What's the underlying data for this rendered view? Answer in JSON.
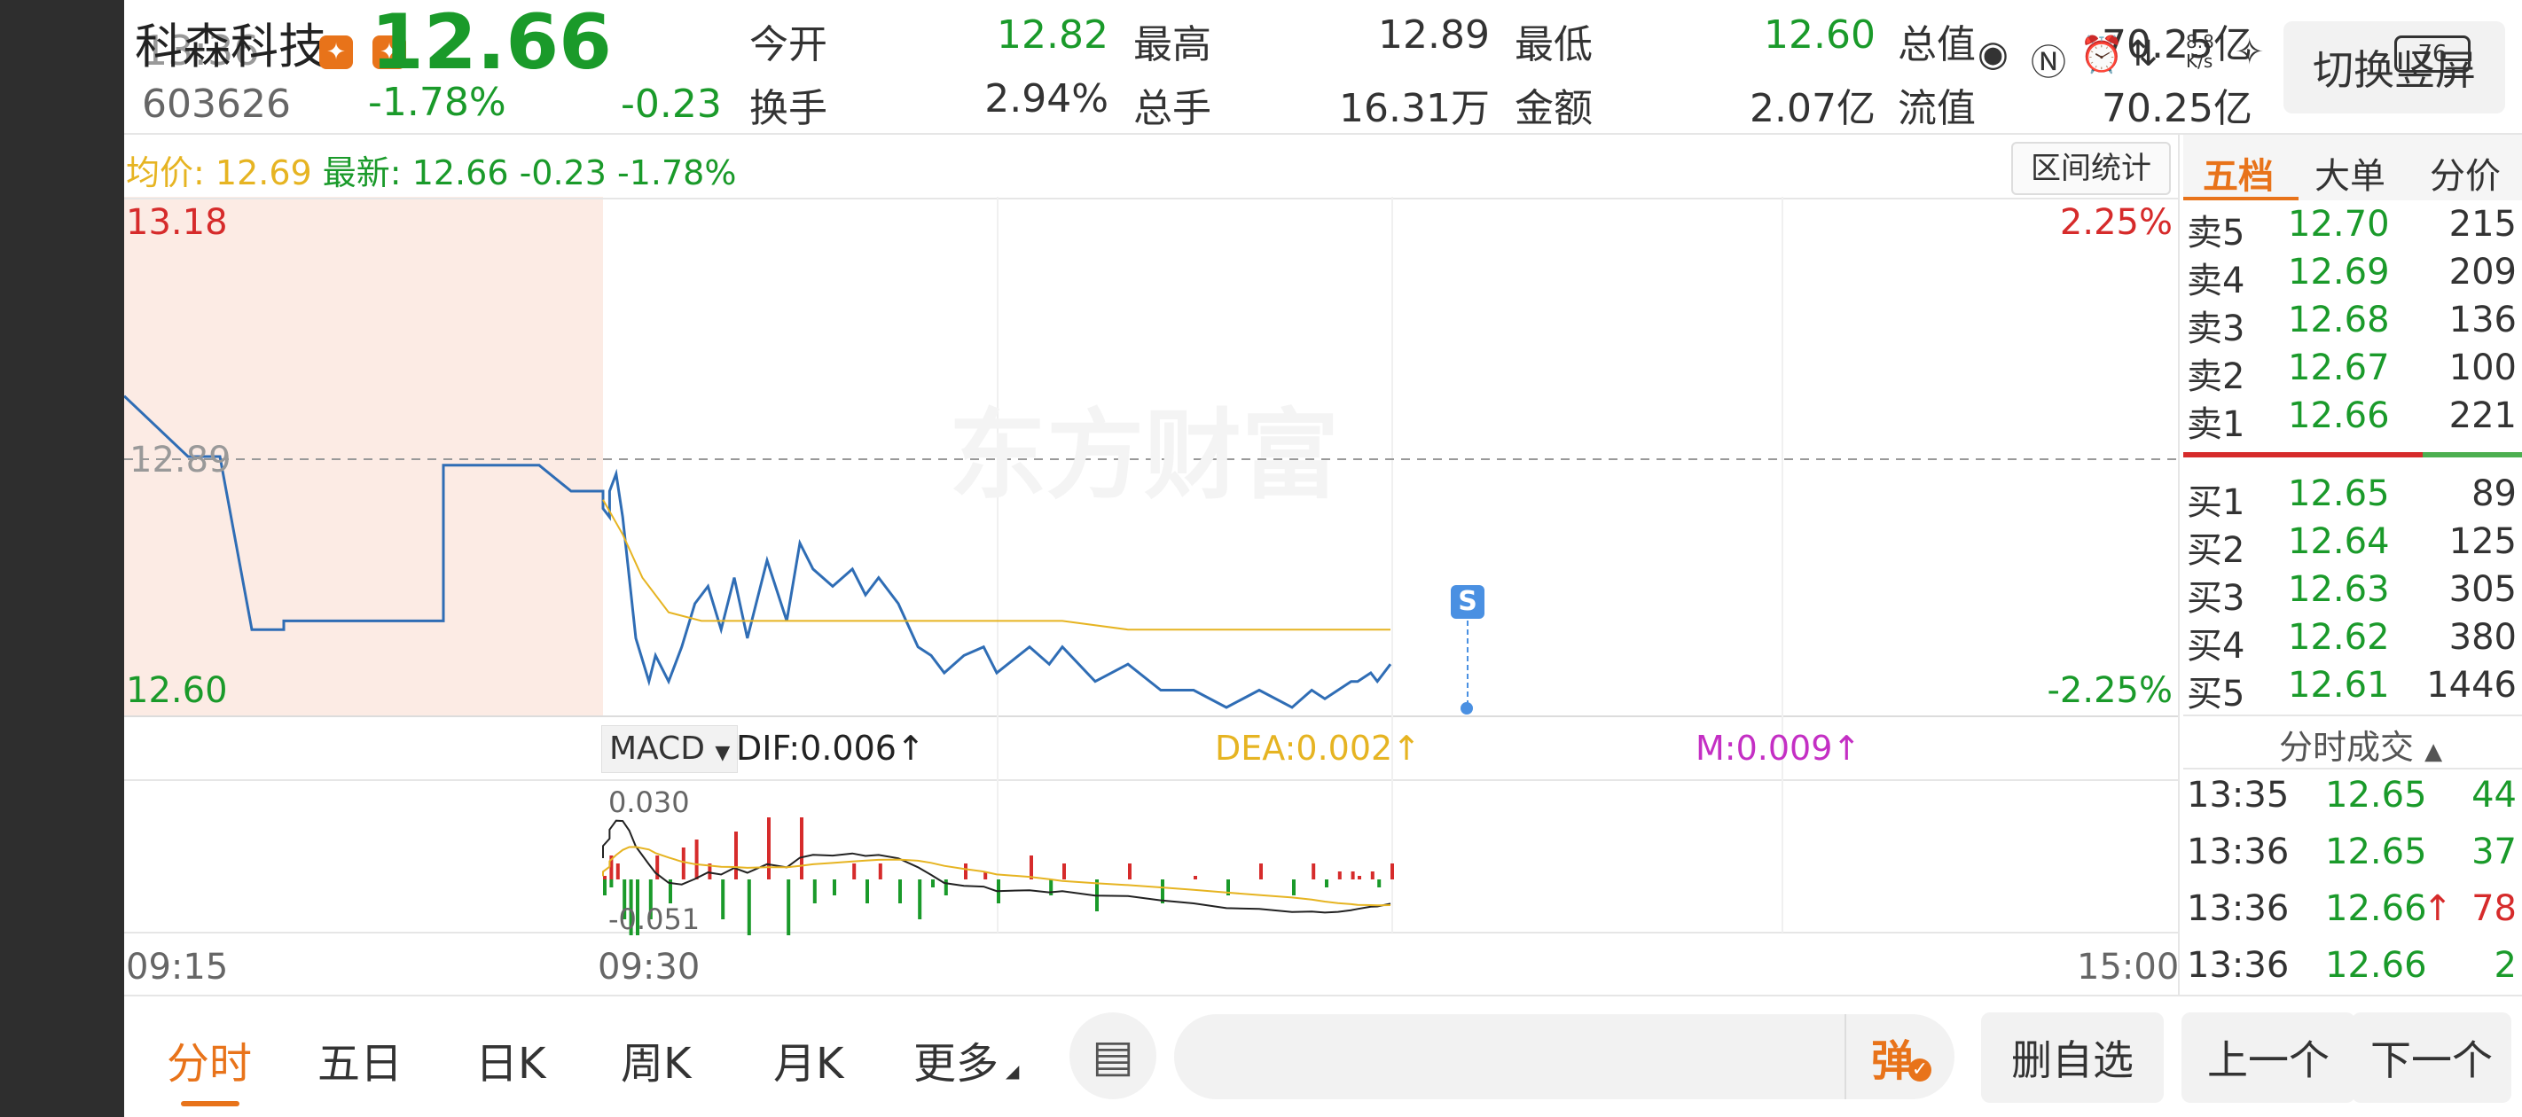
{
  "stock": {
    "name": "科森科技",
    "code": "603626",
    "price": "12.66",
    "change_pct": "-1.78%",
    "change": "-0.23",
    "overlay_time": "13:36"
  },
  "stats": {
    "open_label": "今开",
    "open": "12.82",
    "high_label": "最高",
    "high": "12.89",
    "low_label": "最低",
    "low": "12.60",
    "total_cap_label": "总值",
    "total_cap": "70.25亿",
    "turnover_label": "换手",
    "turnover": "2.94%",
    "volume_label": "总手",
    "volume": "16.31万",
    "amount_label": "金额",
    "amount": "2.07亿",
    "float_cap_label": "流值",
    "float_cap": "70.25亿"
  },
  "statusbar": {
    "speed": "8.8\nK/s",
    "battery": "76"
  },
  "fullscreen_label": "切换竖屏",
  "chart_header": {
    "avg_label": "均价:",
    "avg": "12.69",
    "latest_label": "最新:",
    "latest": "12.66",
    "latest_change": "-0.23",
    "latest_pct": "-1.78%",
    "range_stats": "区间统计"
  },
  "price_axis": {
    "top": "13.18",
    "mid": "12.89",
    "bottom": "12.60",
    "top_pct": "2.25%",
    "bottom_pct": "-2.25%"
  },
  "watermark": "东方财富",
  "signal_marker": "S",
  "macd": {
    "selector": "MACD",
    "dif": "DIF:0.006↑",
    "dea": "DEA:0.002↑",
    "m": "M:0.009↑",
    "axis_top": "0.030",
    "axis_bottom": "-0.051"
  },
  "time_axis": {
    "start": "09:15",
    "open": "09:30",
    "end": "15:00"
  },
  "orderbook": {
    "tabs": [
      "五档",
      "大单",
      "分价"
    ],
    "asks": [
      {
        "label": "卖5",
        "price": "12.70",
        "vol": "215"
      },
      {
        "label": "卖4",
        "price": "12.69",
        "vol": "209"
      },
      {
        "label": "卖3",
        "price": "12.68",
        "vol": "136"
      },
      {
        "label": "卖2",
        "price": "12.67",
        "vol": "100"
      },
      {
        "label": "卖1",
        "price": "12.66",
        "vol": "221"
      }
    ],
    "bids": [
      {
        "label": "买1",
        "price": "12.65",
        "vol": "89"
      },
      {
        "label": "买2",
        "price": "12.64",
        "vol": "125"
      },
      {
        "label": "买3",
        "price": "12.63",
        "vol": "305"
      },
      {
        "label": "买4",
        "price": "12.62",
        "vol": "380"
      },
      {
        "label": "买5",
        "price": "12.61",
        "vol": "1446"
      }
    ]
  },
  "ticks": {
    "title": "分时成交",
    "rows": [
      {
        "time": "13:35",
        "price": "12.65",
        "vol": "44",
        "arrow": ""
      },
      {
        "time": "13:36",
        "price": "12.65",
        "vol": "37",
        "arrow": ""
      },
      {
        "time": "13:36",
        "price": "12.66",
        "vol": "78",
        "arrow": "↑"
      },
      {
        "time": "13:36",
        "price": "12.66",
        "vol": "2",
        "arrow": ""
      }
    ]
  },
  "nav": {
    "tabs": [
      "分时",
      "五日",
      "日K",
      "周K",
      "月K",
      "更多"
    ],
    "danmu_label": "弹",
    "remove_fav": "删自选",
    "prev": "上一个",
    "next": "下一个"
  },
  "colors": {
    "up": "#d62b2b",
    "down": "#1a9a2a",
    "price_line": "#2f6db5",
    "avg_line": "#e6b422",
    "accent": "#e8731a"
  },
  "chart_data": {
    "type": "line",
    "title": "",
    "x_range": [
      "09:15",
      "15:00"
    ],
    "ylim": [
      12.6,
      13.18
    ],
    "ref_price": 12.89,
    "series": [
      {
        "name": "",
        "x": [
          "09:15",
          "09:17",
          "09:18",
          "09:19",
          "09:20",
          "09:20",
          "09:22",
          "09:25",
          "09:25",
          "09:28",
          "09:29",
          "09:30",
          "09:30",
          "09:31",
          "09:31",
          "09:32",
          "09:33",
          "09:34",
          "09:35",
          "09:37",
          "09:38",
          "09:40",
          "09:42",
          "09:44",
          "09:46",
          "09:48",
          "09:50",
          "09:52",
          "09:55",
          "09:58",
          "10:00",
          "10:02",
          "10:05",
          "10:08",
          "10:10",
          "10:12",
          "10:15",
          "10:18",
          "10:20",
          "10:22",
          "10:25",
          "10:28",
          "10:30",
          "10:35",
          "10:38",
          "10:40",
          "10:45",
          "10:50",
          "10:55",
          "11:00",
          "11:05",
          "11:10",
          "11:15",
          "11:18",
          "11:20",
          "11:22",
          "11:24",
          "11:25",
          "11:27",
          "11:28",
          "11:30"
        ],
        "values": [
          12.96,
          12.89,
          12.89,
          12.69,
          12.69,
          12.7,
          12.7,
          12.7,
          12.88,
          12.88,
          12.85,
          12.85,
          12.83,
          12.82,
          12.85,
          12.87,
          12.82,
          12.75,
          12.68,
          12.63,
          12.66,
          12.63,
          12.67,
          12.72,
          12.74,
          12.69,
          12.75,
          12.68,
          12.77,
          12.7,
          12.79,
          12.76,
          12.74,
          12.76,
          12.73,
          12.75,
          12.72,
          12.67,
          12.66,
          12.64,
          12.66,
          12.67,
          12.64,
          12.67,
          12.65,
          12.67,
          12.63,
          12.65,
          12.62,
          12.62,
          12.6,
          12.62,
          12.6,
          12.62,
          12.61,
          12.62,
          12.63,
          12.63,
          12.64,
          12.63,
          12.65
        ]
      },
      {
        "name": "",
        "x": [
          "09:30",
          "09:33",
          "09:36",
          "09:40",
          "09:45",
          "09:50",
          "10:00",
          "10:10",
          "10:20",
          "10:30",
          "10:40",
          "10:50",
          "11:00",
          "11:10",
          "11:20",
          "11:30"
        ],
        "values": [
          12.84,
          12.8,
          12.75,
          12.71,
          12.7,
          12.7,
          12.7,
          12.7,
          12.7,
          12.7,
          12.7,
          12.69,
          12.69,
          12.69,
          12.69,
          12.69
        ]
      }
    ]
  }
}
